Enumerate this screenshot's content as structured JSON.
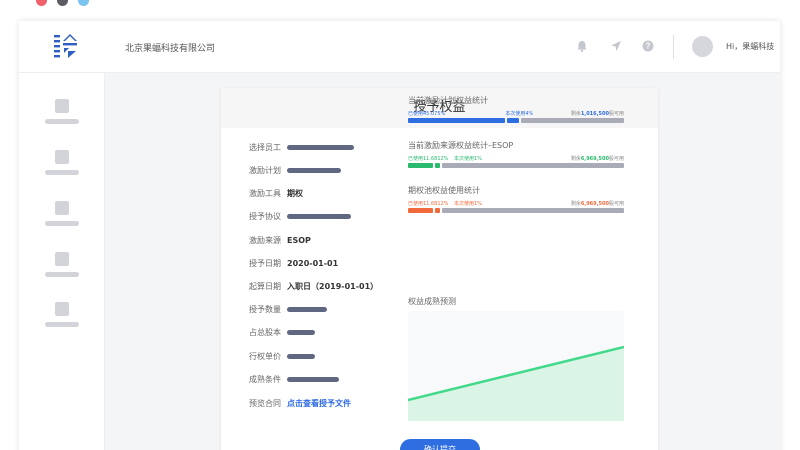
{
  "window_dots": [
    "#f0616b",
    "#5c5c63",
    "#7ac4ef"
  ],
  "brand": {
    "company": "北京果蝠科技有限公司",
    "greeting": "Hi，果蝠科技"
  },
  "topbar_icons": [
    "bell-icon",
    "send-icon",
    "help-icon"
  ],
  "sidebar": {
    "items": [
      "nav-1",
      "nav-2",
      "nav-3",
      "nav-4",
      "nav-5"
    ]
  },
  "form": {
    "title": "授予权益",
    "fields": {
      "employee": {
        "label": "选择员工"
      },
      "plan": {
        "label": "激励计划"
      },
      "tool": {
        "label": "激励工具",
        "value": "期权"
      },
      "agreement": {
        "label": "授予协议"
      },
      "source": {
        "label": "激励来源",
        "value": "ESOP"
      },
      "grant_date": {
        "label": "授予日期",
        "value": "2020-01-01"
      },
      "start_date": {
        "label": "起算日期",
        "value": "入职日（2019-01-01）"
      },
      "quantity": {
        "label": "授予数量"
      },
      "ratio": {
        "label": "占总股本"
      },
      "price": {
        "label": "行权单价"
      },
      "condition": {
        "label": "成熟条件"
      },
      "contract": {
        "label": "预览合同",
        "value": "点击查看授予文件"
      }
    },
    "submit": "确认提交"
  },
  "stats": [
    {
      "title": "当前激励计划权益统计",
      "used_label": "已使用45.075%",
      "current_label": "本次使用4%",
      "remain_prefix": "剩余",
      "remain_value": "1,016,500",
      "remain_suffix": "股可用",
      "used_pct": 45.075,
      "current_pct": 4,
      "used_color": "#2f6ee0",
      "value_color": "#2f6ee0"
    },
    {
      "title": "当前激励来源权益统计–ESOP",
      "used_label": "已使用11.6812%",
      "current_label": "本次使用1%",
      "remain_prefix": "剩余",
      "remain_value": "6,969,500",
      "remain_suffix": "股可用",
      "used_pct": 11.6812,
      "current_pct": 1,
      "used_color": "#2aba6e",
      "value_color": "#2aba6e"
    },
    {
      "title": "期权池权益使用统计",
      "used_label": "已使用11.6812%",
      "current_label": "本次使用1%",
      "remain_prefix": "剩余",
      "remain_value": "6,969,500",
      "remain_suffix": "股可用",
      "used_pct": 11.6812,
      "current_pct": 1,
      "used_color": "#f06a3c",
      "value_color": "#f06a3c"
    }
  ],
  "vesting": {
    "title": "权益成熟预测",
    "line_color": "#43d98b",
    "fill_color": "#daf5e6"
  }
}
